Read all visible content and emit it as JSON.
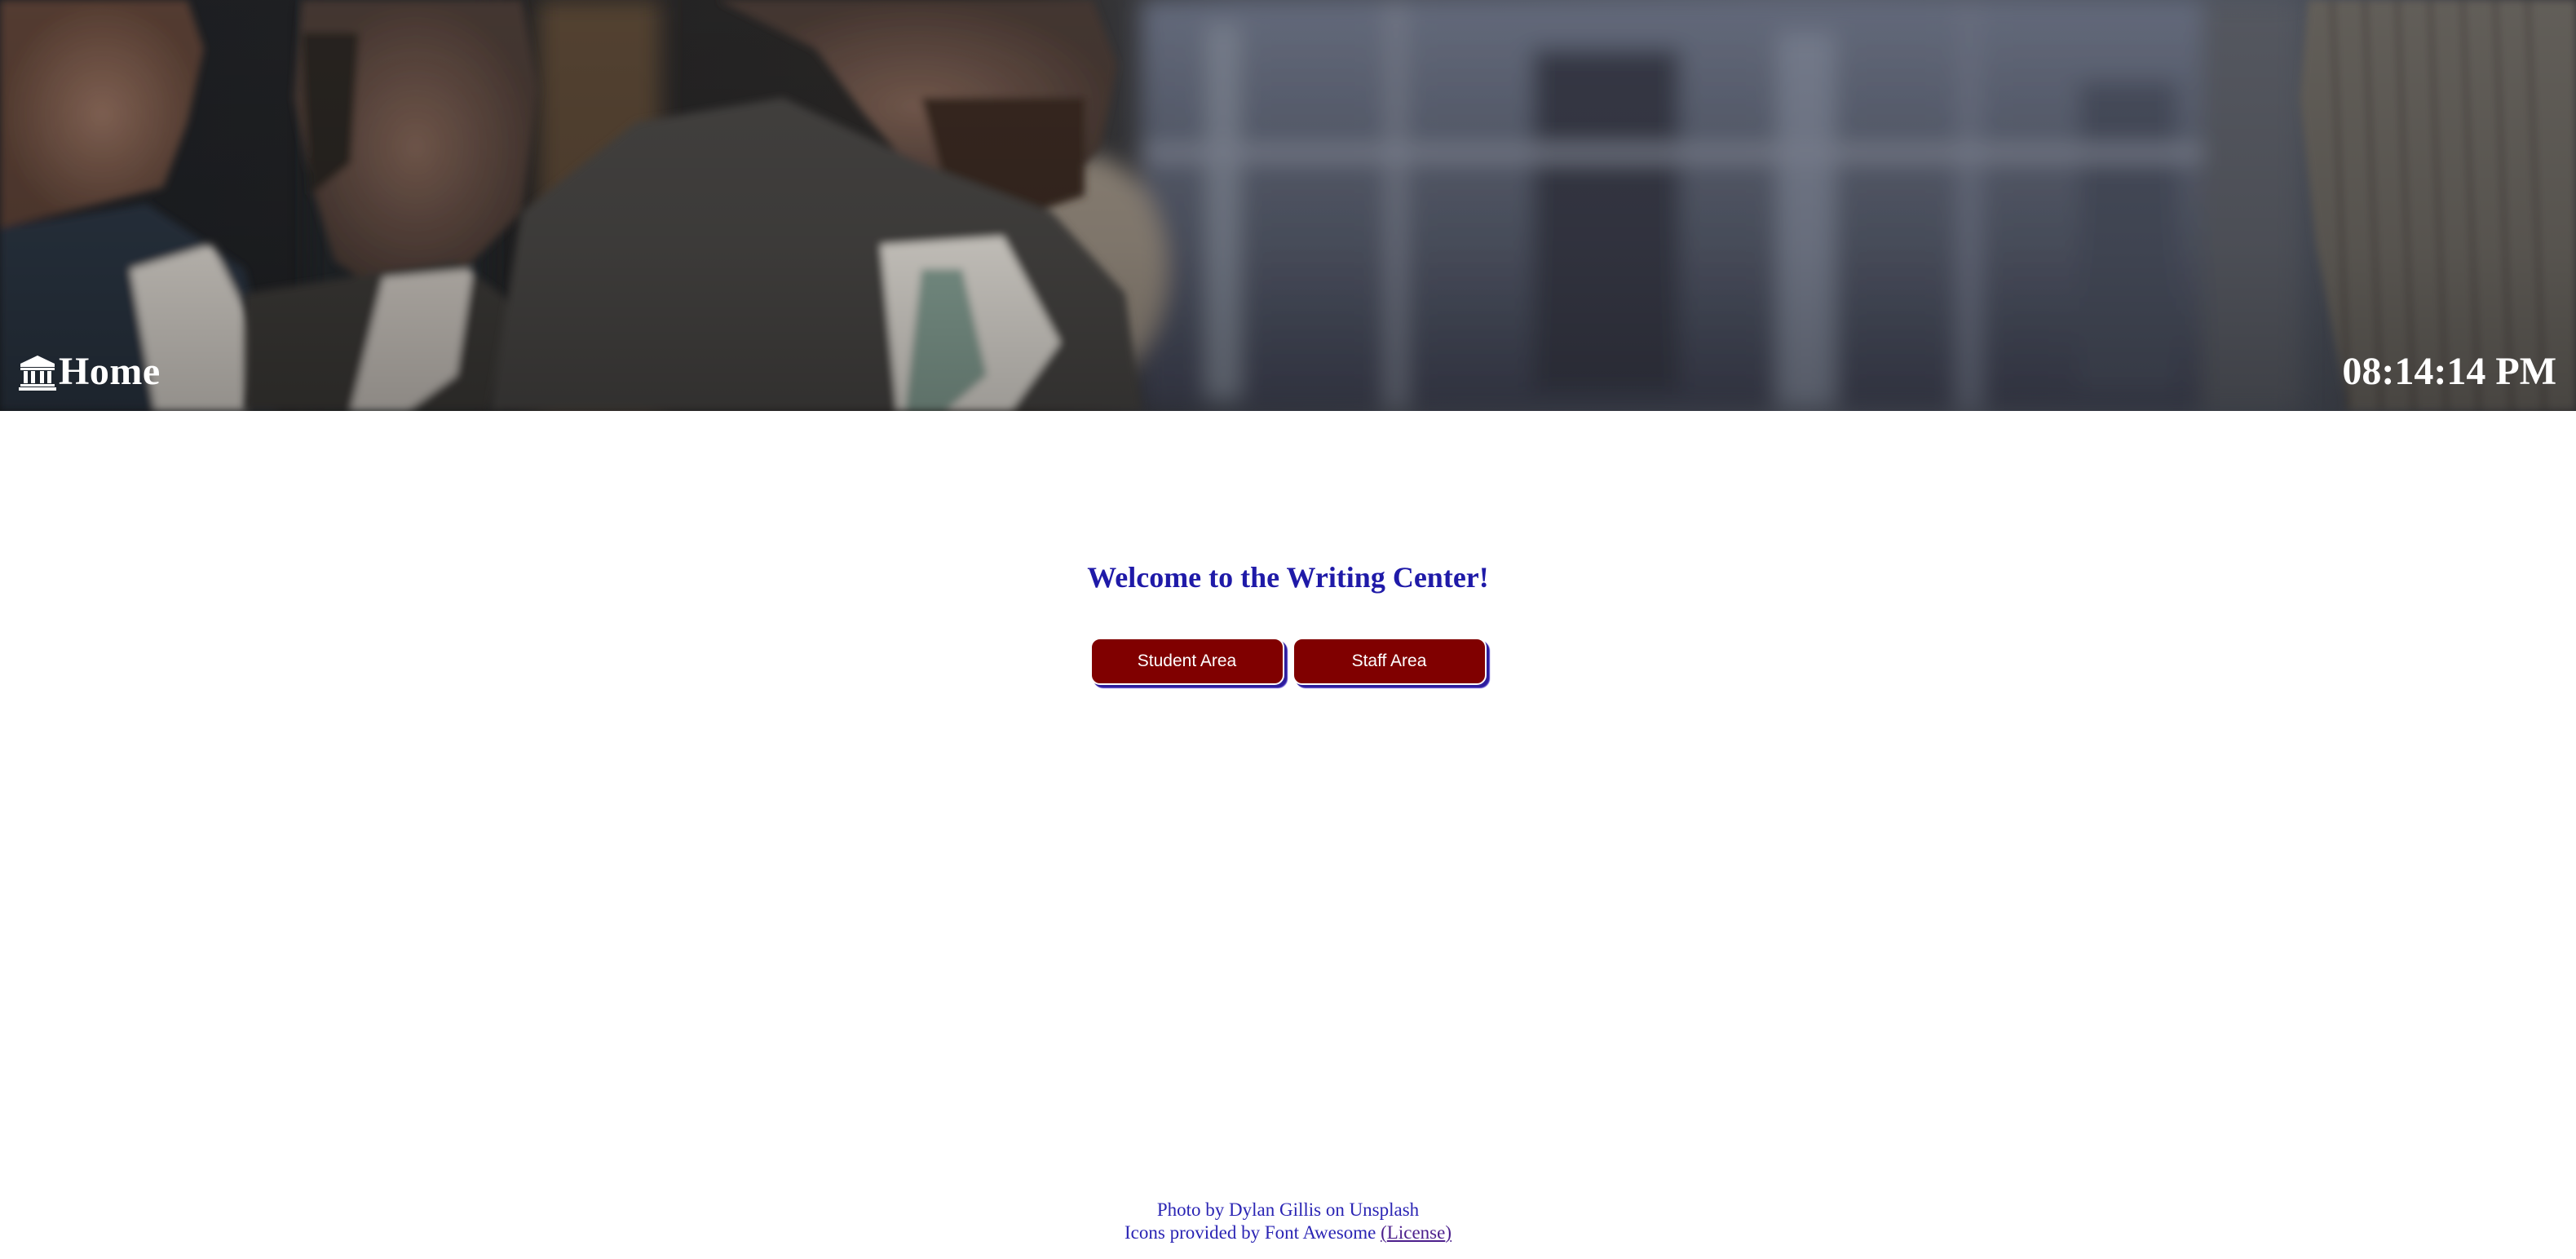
{
  "header": {
    "home_label": "Home",
    "home_icon": "university-icon",
    "clock": "08:14:14 PM"
  },
  "main": {
    "welcome": "Welcome to the Writing Center!",
    "buttons": {
      "student": "Student Area",
      "staff": "Staff Area"
    }
  },
  "footer": {
    "photo_credit": "Photo by Dylan Gillis on Unsplash",
    "icons_credit_prefix": "Icons provided by Font Awesome ",
    "license_open": "(",
    "license_label": "License",
    "license_close": ")"
  },
  "colors": {
    "button_bg": "#800000",
    "heading": "#1f1aa8",
    "footer_text": "#2a24b4",
    "header_text": "#ffffff"
  }
}
